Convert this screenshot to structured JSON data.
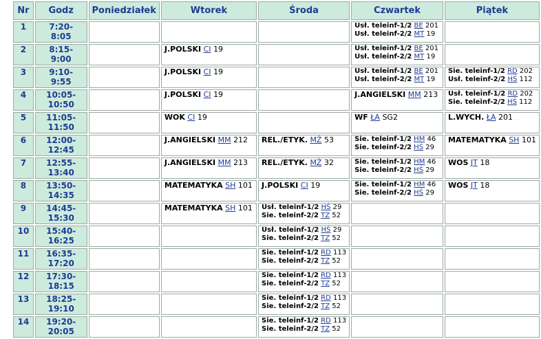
{
  "headers": [
    "Nr",
    "Godz",
    "Poniedziałek",
    "Wtorek",
    "Środa",
    "Czwartek",
    "Piątek"
  ],
  "rows": [
    {
      "nr": "1",
      "godz": "7:20- 8:05",
      "cells": [
        [],
        [],
        [],
        [
          {
            "subject": "Usł. teleinf-1/2",
            "teacher": "BE",
            "room": "201"
          },
          {
            "subject": "Usł. teleinf-2/2",
            "teacher": "MT",
            "room": "19"
          }
        ],
        []
      ]
    },
    {
      "nr": "2",
      "godz": "8:15- 9:00",
      "cells": [
        [],
        [
          {
            "subject": "J.POLSKI",
            "teacher": "CI",
            "room": "19"
          }
        ],
        [],
        [
          {
            "subject": "Usł. teleinf-1/2",
            "teacher": "BE",
            "room": "201"
          },
          {
            "subject": "Usł. teleinf-2/2",
            "teacher": "MT",
            "room": "19"
          }
        ],
        []
      ]
    },
    {
      "nr": "3",
      "godz": "9:10- 9:55",
      "cells": [
        [],
        [
          {
            "subject": "J.POLSKI",
            "teacher": "CI",
            "room": "19"
          }
        ],
        [],
        [
          {
            "subject": "Usł. teleinf-1/2",
            "teacher": "BE",
            "room": "201"
          },
          {
            "subject": "Usł. teleinf-2/2",
            "teacher": "MT",
            "room": "19"
          }
        ],
        [
          {
            "subject": "Sie. teleinf-1/2",
            "teacher": "RD",
            "room": "202"
          },
          {
            "subject": "Usł. teleinf-2/2",
            "teacher": "HŚ",
            "room": "112"
          }
        ]
      ]
    },
    {
      "nr": "4",
      "godz": "10:05-10:50",
      "cells": [
        [],
        [
          {
            "subject": "J.POLSKI",
            "teacher": "CI",
            "room": "19"
          }
        ],
        [],
        [
          {
            "subject": "J.ANGIELSKI",
            "teacher": "MM",
            "room": "213"
          }
        ],
        [
          {
            "subject": "Usł. teleinf-1/2",
            "teacher": "RD",
            "room": "202"
          },
          {
            "subject": "Sie. teleinf-2/2",
            "teacher": "HŚ",
            "room": "112"
          }
        ]
      ]
    },
    {
      "nr": "5",
      "godz": "11:05-11:50",
      "cells": [
        [],
        [
          {
            "subject": "WOK",
            "teacher": "CI",
            "room": "19"
          }
        ],
        [],
        [
          {
            "subject": "WF",
            "teacher": "ŁA",
            "room": "SG2"
          }
        ],
        [
          {
            "subject": "L.WYCH.",
            "teacher": "ŁA",
            "room": "201"
          }
        ]
      ]
    },
    {
      "nr": "6",
      "godz": "12:00-12:45",
      "cells": [
        [],
        [
          {
            "subject": "J.ANGIELSKI",
            "teacher": "MM",
            "room": "212"
          }
        ],
        [
          {
            "subject": "REL./ETYK.",
            "teacher": "MŻ",
            "room": "53"
          }
        ],
        [
          {
            "subject": "Sie. teleinf-1/2",
            "teacher": "HM",
            "room": "46"
          },
          {
            "subject": "Sie. teleinf-2/2",
            "teacher": "HŚ",
            "room": "29"
          }
        ],
        [
          {
            "subject": "MATEMATYKA",
            "teacher": "SH",
            "room": "101"
          }
        ]
      ]
    },
    {
      "nr": "7",
      "godz": "12:55-13:40",
      "cells": [
        [],
        [
          {
            "subject": "J.ANGIELSKI",
            "teacher": "MM",
            "room": "213"
          }
        ],
        [
          {
            "subject": "REL./ETYK.",
            "teacher": "MŻ",
            "room": "32"
          }
        ],
        [
          {
            "subject": "Sie. teleinf-1/2",
            "teacher": "HM",
            "room": "46"
          },
          {
            "subject": "Sie. teleinf-2/2",
            "teacher": "HŚ",
            "room": "29"
          }
        ],
        [
          {
            "subject": "WOS",
            "teacher": "JT",
            "room": "18"
          }
        ]
      ]
    },
    {
      "nr": "8",
      "godz": "13:50-14:35",
      "cells": [
        [],
        [
          {
            "subject": "MATEMATYKA",
            "teacher": "SH",
            "room": "101"
          }
        ],
        [
          {
            "subject": "J.POLSKI",
            "teacher": "CI",
            "room": "19"
          }
        ],
        [
          {
            "subject": "Sie. teleinf-1/2",
            "teacher": "HM",
            "room": "46"
          },
          {
            "subject": "Sie. teleinf-2/2",
            "teacher": "HŚ",
            "room": "29"
          }
        ],
        [
          {
            "subject": "WOS",
            "teacher": "JT",
            "room": "18"
          }
        ]
      ]
    },
    {
      "nr": "9",
      "godz": "14:45-15:30",
      "cells": [
        [],
        [
          {
            "subject": "MATEMATYKA",
            "teacher": "SH",
            "room": "101"
          }
        ],
        [
          {
            "subject": "Usł. teleinf-1/2",
            "teacher": "HŚ",
            "room": "29"
          },
          {
            "subject": "Sie. teleinf-2/2",
            "teacher": "TZ",
            "room": "52"
          }
        ],
        [],
        []
      ]
    },
    {
      "nr": "10",
      "godz": "15:40-16:25",
      "cells": [
        [],
        [],
        [
          {
            "subject": "Usł. teleinf-1/2",
            "teacher": "HŚ",
            "room": "29"
          },
          {
            "subject": "Sie. teleinf-2/2",
            "teacher": "TZ",
            "room": "52"
          }
        ],
        [],
        []
      ]
    },
    {
      "nr": "11",
      "godz": "16:35-17:20",
      "cells": [
        [],
        [],
        [
          {
            "subject": "Sie. teleinf-1/2",
            "teacher": "RD",
            "room": "113"
          },
          {
            "subject": "Sie. teleinf-2/2",
            "teacher": "TZ",
            "room": "52"
          }
        ],
        [],
        []
      ]
    },
    {
      "nr": "12",
      "godz": "17:30-18:15",
      "cells": [
        [],
        [],
        [
          {
            "subject": "Sie. teleinf-1/2",
            "teacher": "RD",
            "room": "113"
          },
          {
            "subject": "Sie. teleinf-2/2",
            "teacher": "TZ",
            "room": "52"
          }
        ],
        [],
        []
      ]
    },
    {
      "nr": "13",
      "godz": "18:25-19:10",
      "cells": [
        [],
        [],
        [
          {
            "subject": "Sie. teleinf-1/2",
            "teacher": "RD",
            "room": "113"
          },
          {
            "subject": "Sie. teleinf-2/2",
            "teacher": "TZ",
            "room": "52"
          }
        ],
        [],
        []
      ]
    },
    {
      "nr": "14",
      "godz": "19:20-20:05",
      "cells": [
        [],
        [],
        [
          {
            "subject": "Sie. teleinf-1/2",
            "teacher": "RD",
            "room": "113"
          },
          {
            "subject": "Sie. teleinf-2/2",
            "teacher": "TZ",
            "room": "52"
          }
        ],
        [],
        []
      ]
    }
  ]
}
